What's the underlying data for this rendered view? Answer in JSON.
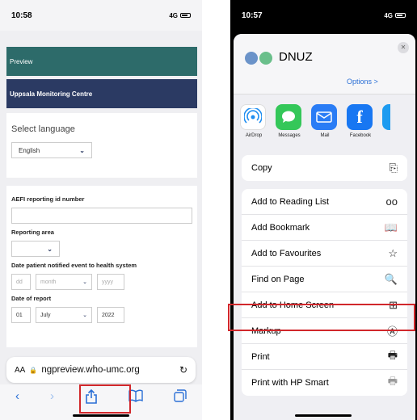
{
  "left": {
    "status": {
      "time": "10:58",
      "signal": "4G"
    },
    "preview_label": "Preview",
    "org_name": "Uppsala Monitoring Centre",
    "select_language_label": "Select language",
    "language_value": "English",
    "aefi_label": "AEFI reporting id number",
    "reporting_area_label": "Reporting area",
    "date_notified_label": "Date patient notified event to health system",
    "date_notified": {
      "day": "dd",
      "month": "month",
      "year": "yyyy"
    },
    "date_of_report_label": "Date of report",
    "date_of_report": {
      "day": "01",
      "month": "July",
      "year": "2022"
    },
    "url_text": "ngpreview.who-umc.org",
    "aa_label": "AA"
  },
  "right": {
    "status": {
      "time": "10:57",
      "signal": "4G"
    },
    "sheet_title": "DNUZ",
    "options_label": "Options >",
    "apps": [
      {
        "name": "AirDrop",
        "color": "#1f8ef1"
      },
      {
        "name": "Messages",
        "color": "#34c759"
      },
      {
        "name": "Mail",
        "color": "#2a7cf5"
      },
      {
        "name": "Facebook",
        "color": "#1877f2"
      }
    ],
    "copy_label": "Copy",
    "actions": [
      {
        "label": "Add to Reading List",
        "icon": "glasses-icon"
      },
      {
        "label": "Add Bookmark",
        "icon": "book-icon"
      },
      {
        "label": "Add to Favourites",
        "icon": "star-icon"
      },
      {
        "label": "Find on Page",
        "icon": "find-icon"
      },
      {
        "label": "Add to Home Screen",
        "icon": "plus-square-icon"
      },
      {
        "label": "Markup",
        "icon": "markup-icon"
      },
      {
        "label": "Print",
        "icon": "printer-icon"
      },
      {
        "label": "Print with HP Smart",
        "icon": "hp-print-icon"
      }
    ]
  },
  "colors": {
    "highlight": "#d1272b",
    "teal": "#2d6b6a",
    "navy": "#2b3a63"
  }
}
